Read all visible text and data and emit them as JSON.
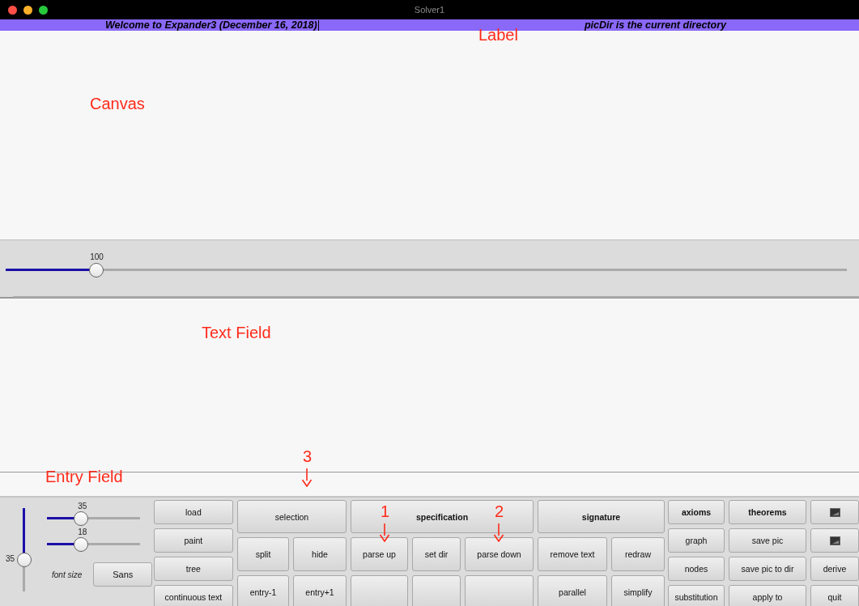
{
  "window": {
    "title": "Solver1"
  },
  "label_bar": {
    "left_text": "Welcome to Expander3 (December 16, 2018)",
    "right_text": "picDir is the current directory"
  },
  "main_slider": {
    "value": "100",
    "level": 0.1
  },
  "side_controls": {
    "vertical_slider": {
      "value": "35",
      "level": 0.42
    },
    "sliders": [
      {
        "value": "35",
        "level": 0.31
      },
      {
        "value": "18",
        "level": 0.31
      }
    ],
    "font_size_label": "font size",
    "font_button": "Sans"
  },
  "left_buttons": [
    {
      "label": "load"
    },
    {
      "label": "paint"
    },
    {
      "label": "tree"
    },
    {
      "label": "continuous text"
    }
  ],
  "middle_buttons": [
    {
      "kind": "text",
      "label": "selection",
      "bold": false
    },
    {
      "kind": "text",
      "label": "specification",
      "bold": true
    },
    {
      "kind": "text",
      "label": "signature",
      "bold": true
    },
    {
      "kind": "text",
      "label": "split",
      "bold": false
    },
    {
      "kind": "text",
      "label": "hide",
      "bold": false
    },
    {
      "kind": "text",
      "label": "parse up",
      "bold": false
    },
    {
      "kind": "text",
      "label": "set dir",
      "bold": false
    },
    {
      "kind": "text",
      "label": "parse down",
      "bold": false
    },
    {
      "kind": "text",
      "label": "remove text",
      "bold": false
    },
    {
      "kind": "text",
      "label": "redraw",
      "bold": false
    },
    {
      "kind": "text",
      "label": "entry-1",
      "bold": false
    },
    {
      "kind": "text",
      "label": "entry+1",
      "bold": false
    },
    {
      "kind": "blank"
    },
    {
      "kind": "blank"
    },
    {
      "kind": "blank"
    },
    {
      "kind": "text",
      "label": "parallel",
      "bold": false
    },
    {
      "kind": "text",
      "label": "simplify",
      "bold": false
    }
  ],
  "right_buttons": [
    {
      "kind": "text",
      "label": "axioms",
      "bold": true
    },
    {
      "kind": "text",
      "label": "theorems",
      "bold": true
    },
    {
      "kind": "icon"
    },
    {
      "kind": "text",
      "label": "graph",
      "bold": false
    },
    {
      "kind": "text",
      "label": "save pic",
      "bold": false
    },
    {
      "kind": "icon"
    },
    {
      "kind": "text",
      "label": "nodes",
      "bold": false
    },
    {
      "kind": "text",
      "label": "save pic to dir",
      "bold": false
    },
    {
      "kind": "text",
      "label": "derive",
      "bold": false
    },
    {
      "kind": "text",
      "label": "substitution",
      "bold": false
    },
    {
      "kind": "text",
      "label": "apply to",
      "bold": false
    },
    {
      "kind": "text",
      "label": "quit",
      "bold": false
    }
  ],
  "annotations": [
    {
      "kind": "label",
      "text": "Label"
    },
    {
      "kind": "label",
      "text": "Canvas"
    },
    {
      "kind": "label",
      "text": "Text Field"
    },
    {
      "kind": "label",
      "text": "Entry Field"
    },
    {
      "kind": "arrow",
      "text": "3"
    },
    {
      "kind": "arrow",
      "text": "1"
    },
    {
      "kind": "arrow",
      "text": "2"
    }
  ]
}
